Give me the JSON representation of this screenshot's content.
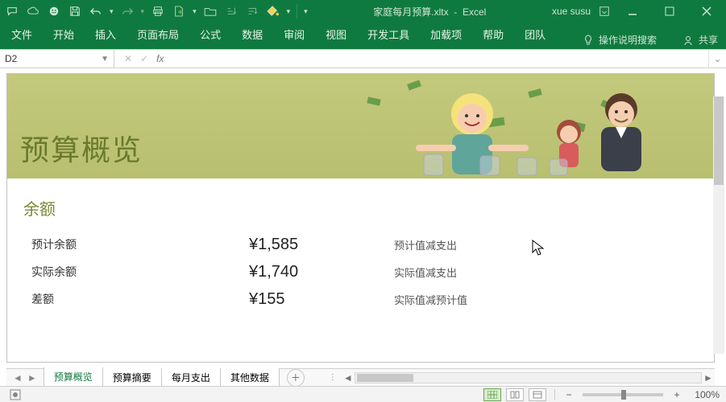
{
  "titlebar": {
    "filename": "家庭每月预算.xltx",
    "app": "Excel",
    "user": "xue susu"
  },
  "ribbon": {
    "tabs": [
      "文件",
      "开始",
      "插入",
      "页面布局",
      "公式",
      "数据",
      "审阅",
      "视图",
      "开发工具",
      "加载项",
      "帮助",
      "团队"
    ],
    "tell_me": "操作说明搜索",
    "share": "共享"
  },
  "formula": {
    "namebox": "D2",
    "value": ""
  },
  "banner": {
    "title": "预算概览"
  },
  "section": {
    "heading": "余额",
    "rows": [
      {
        "label": "预计余额",
        "value": "¥1,585",
        "desc": "预计值减支出"
      },
      {
        "label": "实际余额",
        "value": "¥1,740",
        "desc": "实际值减支出"
      },
      {
        "label": "差额",
        "value": "¥155",
        "desc": "实际值减预计值"
      }
    ]
  },
  "sheets": [
    "预算概览",
    "预算摘要",
    "每月支出",
    "其他数据"
  ],
  "status": {
    "zoom": "100%"
  }
}
